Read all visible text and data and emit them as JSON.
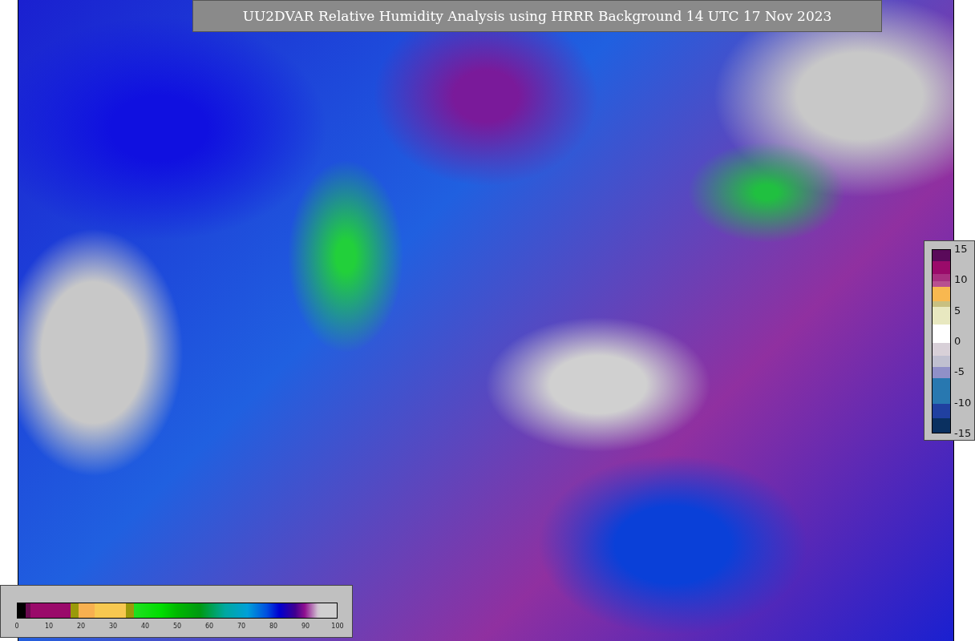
{
  "title": "UU2DVAR Relative Humidity Analysis using HRRR Background 14 UTC 17 Nov 2023",
  "humidity_colorbar": {
    "ticks": [
      "0",
      "10",
      "20",
      "30",
      "40",
      "50",
      "60",
      "70",
      "80",
      "90",
      "100"
    ]
  },
  "difference_colorbar": {
    "ticks": [
      "15",
      "10",
      "5",
      "0",
      "-5",
      "-10",
      "-15"
    ]
  }
}
